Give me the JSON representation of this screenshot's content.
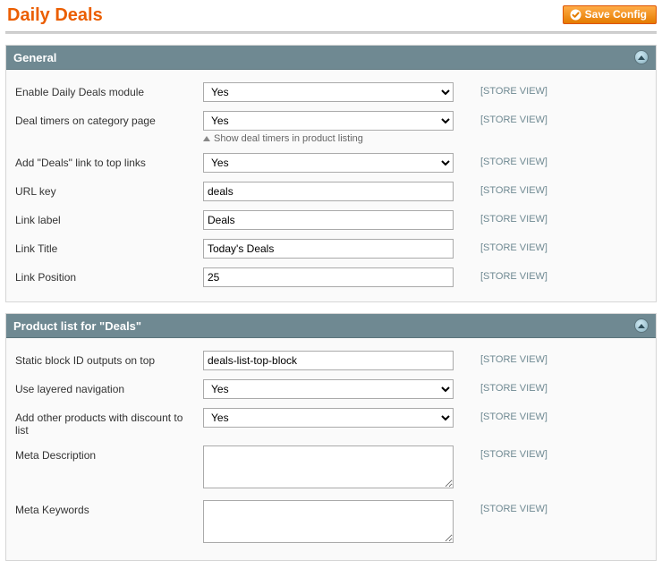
{
  "page": {
    "title": "Daily Deals",
    "save_button_label": "Save Config"
  },
  "sections": [
    {
      "title": "General",
      "fields": {
        "enable": {
          "label": "Enable Daily Deals module",
          "value": "Yes",
          "type": "select",
          "scope": "[STORE VIEW]"
        },
        "timers": {
          "label": "Deal timers on category page",
          "value": "Yes",
          "type": "select",
          "scope": "[STORE VIEW]",
          "comment": "Show deal timers in product listing"
        },
        "addlink": {
          "label": "Add \"Deals\" link to top links",
          "value": "Yes",
          "type": "select",
          "scope": "[STORE VIEW]"
        },
        "urlkey": {
          "label": "URL key",
          "value": "deals",
          "type": "text",
          "scope": "[STORE VIEW]"
        },
        "linklabel": {
          "label": "Link label",
          "value": "Deals",
          "type": "text",
          "scope": "[STORE VIEW]"
        },
        "linktitle": {
          "label": "Link Title",
          "value": "Today's Deals",
          "type": "text",
          "scope": "[STORE VIEW]"
        },
        "linkposition": {
          "label": "Link Position",
          "value": "25",
          "type": "text",
          "scope": "[STORE VIEW]"
        }
      }
    },
    {
      "title": "Product list for \"Deals\"",
      "fields": {
        "staticblock": {
          "label": "Static block ID outputs on top",
          "value": "deals-list-top-block",
          "type": "text",
          "scope": "[STORE VIEW]"
        },
        "layered": {
          "label": "Use layered navigation",
          "value": "Yes",
          "type": "select",
          "scope": "[STORE VIEW]"
        },
        "addother": {
          "label": "Add other products with discount to list",
          "value": "Yes",
          "type": "select",
          "scope": "[STORE VIEW]"
        },
        "metadesc": {
          "label": "Meta Description",
          "value": "",
          "type": "textarea",
          "scope": "[STORE VIEW]"
        },
        "metakeys": {
          "label": "Meta Keywords",
          "value": "",
          "type": "textarea",
          "scope": "[STORE VIEW]"
        }
      }
    }
  ]
}
